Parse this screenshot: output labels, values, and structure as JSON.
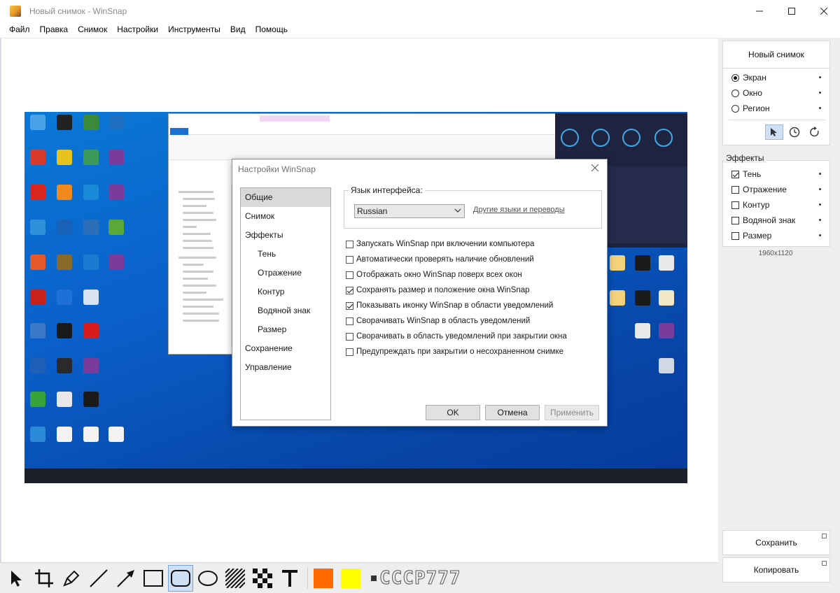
{
  "window": {
    "title": "Новый снимок - WinSnap"
  },
  "menu": [
    "Файл",
    "Правка",
    "Снимок",
    "Настройки",
    "Инструменты",
    "Вид",
    "Помощь"
  ],
  "panel": {
    "new_snapshot": "Новый снимок",
    "capture_modes": [
      {
        "label": "Экран",
        "selected": true
      },
      {
        "label": "Окно",
        "selected": false
      },
      {
        "label": "Регион",
        "selected": false
      }
    ],
    "effects_title": "Эффекты",
    "effects": [
      {
        "label": "Тень",
        "checked": true
      },
      {
        "label": "Отражение",
        "checked": false
      },
      {
        "label": "Контур",
        "checked": false
      },
      {
        "label": "Водяной знак",
        "checked": false
      },
      {
        "label": "Размер",
        "checked": false
      }
    ],
    "image_size": "1960x1120",
    "save": "Сохранить",
    "copy": "Копировать"
  },
  "toolbar": {
    "tools": [
      "pointer-icon",
      "crop-icon",
      "pen-icon",
      "line-icon",
      "arrow-icon",
      "rectangle-icon",
      "rounded-rectangle-icon",
      "ellipse-icon",
      "hatch-icon",
      "pixelate-icon",
      "text-icon"
    ],
    "selected_tool": "rounded-rectangle-icon",
    "fill_color": "#ff6a00",
    "highlight_color": "#ffff00",
    "pen_sample": "СССР777"
  },
  "dialog": {
    "title": "Настройки WinSnap",
    "nav": [
      {
        "label": "Общие",
        "sub": false,
        "selected": true
      },
      {
        "label": "Снимок",
        "sub": false,
        "selected": false
      },
      {
        "label": "Эффекты",
        "sub": false,
        "selected": false
      },
      {
        "label": "Тень",
        "sub": true,
        "selected": false
      },
      {
        "label": "Отражение",
        "sub": true,
        "selected": false
      },
      {
        "label": "Контур",
        "sub": true,
        "selected": false
      },
      {
        "label": "Водяной знак",
        "sub": true,
        "selected": false
      },
      {
        "label": "Размер",
        "sub": true,
        "selected": false
      },
      {
        "label": "Сохранение",
        "sub": false,
        "selected": false
      },
      {
        "label": "Управление",
        "sub": false,
        "selected": false
      }
    ],
    "language_label": "Язык интерфейса:",
    "language_value": "Russian",
    "language_link": "Другие языки и переводы",
    "options": [
      {
        "label": "Запускать WinSnap при включении компьютера",
        "checked": false
      },
      {
        "label": "Автоматически проверять наличие обновлений",
        "checked": false
      },
      {
        "label": "Отображать окно WinSnap поверх всех окон",
        "checked": false
      },
      {
        "label": "Сохранять размер и положение окна WinSnap",
        "checked": true
      },
      {
        "label": "Показывать иконку WinSnap в области уведомлений",
        "checked": true
      },
      {
        "label": "Сворачивать WinSnap в область уведомлений",
        "checked": false
      },
      {
        "label": "Сворачивать в область уведомлений при закрытии окна",
        "checked": false
      },
      {
        "label": "Предупреждать при закрытии о несохраненном снимке",
        "checked": false
      }
    ],
    "ok": "OK",
    "cancel": "Отмена",
    "apply": "Применить"
  }
}
